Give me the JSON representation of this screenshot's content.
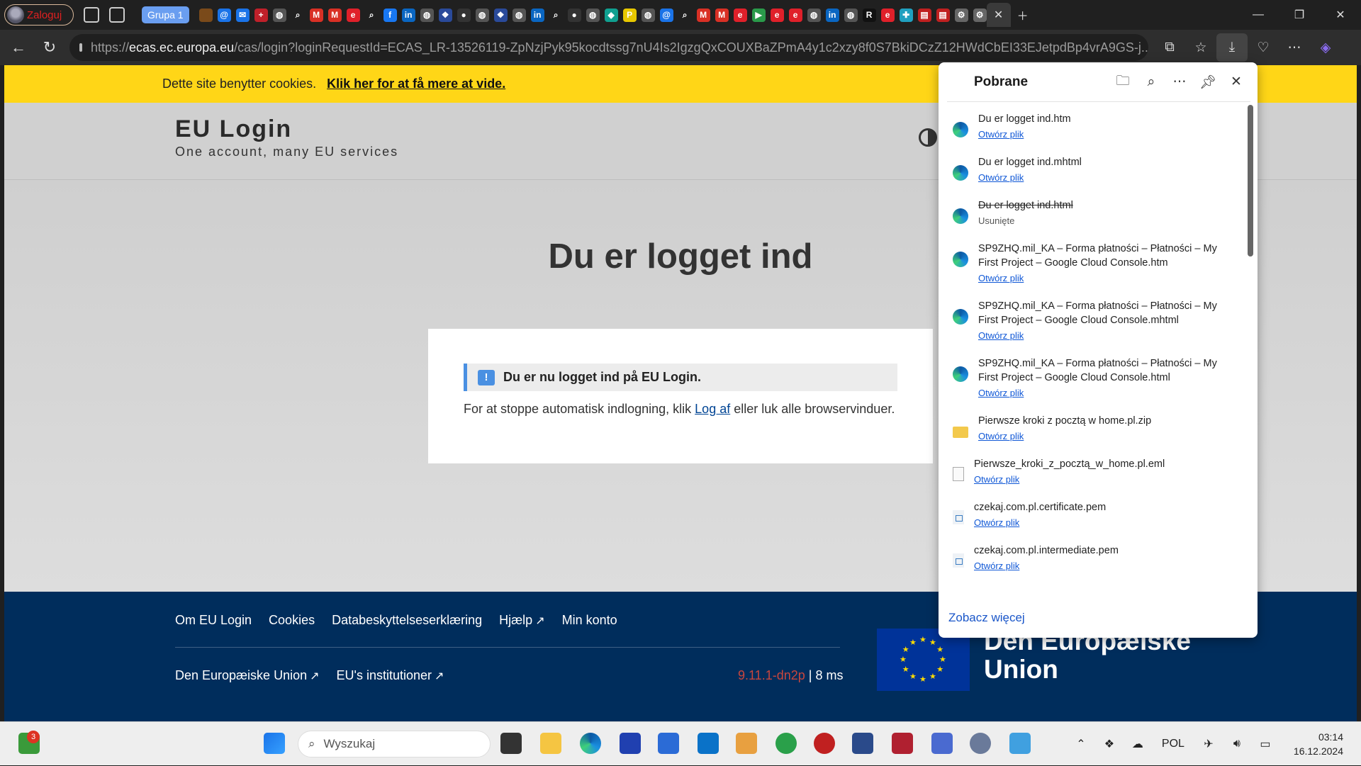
{
  "browser": {
    "profile_label": "Zaloguj",
    "tab_group": "Grupa 1",
    "tab_favicons": [
      {
        "icon": "feather-icon",
        "color": "#7a4a1a",
        "glyph": ""
      },
      {
        "icon": "at-mail-icon",
        "color": "#1a73e8",
        "glyph": "@"
      },
      {
        "icon": "mail-icon",
        "color": "#1a73e8",
        "glyph": "✉"
      },
      {
        "icon": "plus-red-icon",
        "color": "#c0202a",
        "glyph": "+"
      },
      {
        "icon": "globe-icon",
        "color": "#555",
        "glyph": "◍"
      },
      {
        "icon": "search-icon",
        "color": "#202020",
        "glyph": "⌕"
      },
      {
        "icon": "gmail-icon",
        "color": "#d93025",
        "glyph": "M"
      },
      {
        "icon": "gmail-icon",
        "color": "#d93025",
        "glyph": "M"
      },
      {
        "icon": "e-red-icon",
        "color": "#e0202a",
        "glyph": "e"
      },
      {
        "icon": "search-icon",
        "color": "#202020",
        "glyph": "⌕"
      },
      {
        "icon": "facebook-icon",
        "color": "#1877f2",
        "glyph": "f"
      },
      {
        "icon": "linkedin-icon",
        "color": "#0a66c2",
        "glyph": "in"
      },
      {
        "icon": "globe-icon",
        "color": "#555",
        "glyph": "◍"
      },
      {
        "icon": "dropbox-icon",
        "color": "#2a4a9a",
        "glyph": "❖"
      },
      {
        "icon": "github-icon",
        "color": "#333",
        "glyph": "●"
      },
      {
        "icon": "globe-icon",
        "color": "#555",
        "glyph": "◍"
      },
      {
        "icon": "dropbox-icon",
        "color": "#2a4a9a",
        "glyph": "❖"
      },
      {
        "icon": "globe-icon",
        "color": "#555",
        "glyph": "◍"
      },
      {
        "icon": "linkedin-icon",
        "color": "#0a66c2",
        "glyph": "in"
      },
      {
        "icon": "search-icon",
        "color": "#202020",
        "glyph": "⌕"
      },
      {
        "icon": "github-icon",
        "color": "#333",
        "glyph": "●"
      },
      {
        "icon": "globe-icon",
        "color": "#555",
        "glyph": "◍"
      },
      {
        "icon": "diamond-icon",
        "color": "#10a090",
        "glyph": "◆"
      },
      {
        "icon": "p-yellow-icon",
        "color": "#e8c800",
        "glyph": "P"
      },
      {
        "icon": "globe-icon",
        "color": "#555",
        "glyph": "◍"
      },
      {
        "icon": "at-mail-icon",
        "color": "#1a73e8",
        "glyph": "@"
      },
      {
        "icon": "search-icon",
        "color": "#202020",
        "glyph": "⌕"
      },
      {
        "icon": "gmail-icon",
        "color": "#d93025",
        "glyph": "M"
      },
      {
        "icon": "gmail-icon",
        "color": "#d93025",
        "glyph": "M"
      },
      {
        "icon": "e-red-icon",
        "color": "#e0202a",
        "glyph": "e"
      },
      {
        "icon": "play-icon",
        "color": "#2a9a4a",
        "glyph": "▶"
      },
      {
        "icon": "e-red-icon",
        "color": "#e0202a",
        "glyph": "e"
      },
      {
        "icon": "e-red-icon",
        "color": "#e0202a",
        "glyph": "e"
      },
      {
        "icon": "globe-icon",
        "color": "#555",
        "glyph": "◍"
      },
      {
        "icon": "linkedin-icon",
        "color": "#0a66c2",
        "glyph": "in"
      },
      {
        "icon": "globe-icon",
        "color": "#555",
        "glyph": "◍"
      },
      {
        "icon": "r-icon",
        "color": "#111",
        "glyph": "R"
      },
      {
        "icon": "e-red-icon",
        "color": "#e0202a",
        "glyph": "e"
      },
      {
        "icon": "puzzle-icon",
        "color": "#20a0c0",
        "glyph": "✚"
      },
      {
        "icon": "pdf-icon",
        "color": "#c02020",
        "glyph": "▤"
      },
      {
        "icon": "pdf-icon",
        "color": "#c02020",
        "glyph": "▤"
      },
      {
        "icon": "gear-icon",
        "color": "#666",
        "glyph": "⚙"
      },
      {
        "icon": "gear-icon",
        "color": "#666",
        "glyph": "⚙"
      }
    ],
    "url_prefix": "https://",
    "url_host": "ecas.ec.europa.eu",
    "url_rest": "/cas/login?loginRequestId=ECAS_LR-13526119-ZpNzjPyk95kocdtssg7nU4Is2IgzgQxCOUXBaZPmA4y1c2xzy8f0S7BkiDCzZ12HWdCbEI33EJetpdBp4vrA9GS-j..."
  },
  "cookie_banner": {
    "text": "Dette site benytter cookies.",
    "link": "Klik her for at få mere at vide."
  },
  "site": {
    "title": "EU Login",
    "subtitle": "One account, many EU services"
  },
  "main": {
    "heading": "Du er logget ind",
    "alert": "Du er nu logget ind på EU Login.",
    "msg_before": "For at stoppe automatisk indlogning, klik ",
    "msg_link": "Log af",
    "msg_after": " eller luk alle browservinduer."
  },
  "footer": {
    "links": [
      "Om EU Login",
      "Cookies",
      "Databeskyttelseserklæring",
      "Hjælp",
      "Min konto"
    ],
    "links2": [
      "Den Europæiske Union",
      "EU's institutioner"
    ],
    "version": "9.11.1-dn2p",
    "time": "8 ms",
    "eu_line1": "Den Europæiske",
    "eu_line2": "Union"
  },
  "downloads": {
    "title": "Pobrane",
    "items": [
      {
        "name": "Du er logget ind.htm",
        "action": "Otwórz plik",
        "type": "edge"
      },
      {
        "name": "Du er logget ind.mhtml",
        "action": "Otwórz plik",
        "type": "edge"
      },
      {
        "name": "Du er logget ind.html",
        "action": "Usunięte",
        "type": "edge",
        "deleted": true
      },
      {
        "name": "SP9ZHQ.mil_KA – Forma płatności – Płatności – My First Project – Google Cloud Console.htm",
        "action": "Otwórz plik",
        "type": "edge"
      },
      {
        "name": "SP9ZHQ.mil_KA – Forma płatności – Płatności – My First Project – Google Cloud Console.mhtml",
        "action": "Otwórz plik",
        "type": "edge"
      },
      {
        "name": "SP9ZHQ.mil_KA – Forma płatności – Płatności – My First Project – Google Cloud Console.html",
        "action": "Otwórz plik",
        "type": "edge"
      },
      {
        "name": "Pierwsze kroki z pocztą w home.pl.zip",
        "action": "Otwórz plik",
        "type": "zip"
      },
      {
        "name": "Pierwsze_kroki_z_pocztą_w_home.pl.eml",
        "action": "Otwórz plik",
        "type": "doc"
      },
      {
        "name": "czekaj.com.pl.certificate.pem",
        "action": "Otwórz plik",
        "type": "pem"
      },
      {
        "name": "czekaj.com.pl.intermediate.pem",
        "action": "Otwórz plik",
        "type": "pem"
      }
    ],
    "see_more": "Zobacz więcej"
  },
  "taskbar": {
    "badge": "3",
    "search_placeholder": "Wyszukaj",
    "language": "POL",
    "time": "03:14",
    "date": "16.12.2024"
  }
}
